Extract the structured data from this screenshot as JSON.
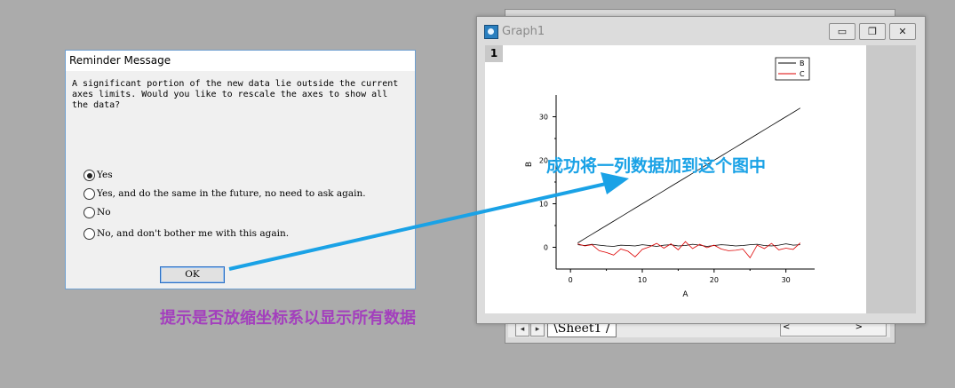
{
  "worksheet": {
    "sheet_tab": "Sheet1",
    "nav_prev": "◂",
    "nav_next": "▸",
    "scroll_left": "<",
    "scroll_right": ">"
  },
  "graph_window": {
    "title": "Graph1",
    "layer_number": "1",
    "minimize": "▭",
    "restore": "❐",
    "close": "✕"
  },
  "chart_data": {
    "type": "line",
    "xlabel": "A",
    "ylabel": "B",
    "xticks": [
      "0",
      "10",
      "20",
      "30"
    ],
    "yticks": [
      "0",
      "10",
      "20",
      "30"
    ],
    "xlim": [
      -2,
      34
    ],
    "ylim": [
      -5,
      35
    ],
    "x": [
      1,
      2,
      3,
      4,
      5,
      6,
      7,
      8,
      9,
      10,
      11,
      12,
      13,
      14,
      15,
      16,
      17,
      18,
      19,
      20,
      21,
      22,
      23,
      24,
      25,
      26,
      27,
      28,
      29,
      30,
      31,
      32
    ],
    "series": [
      {
        "name": "B",
        "color": "#000000",
        "lines": [
          {
            "x": [
              1,
              2,
              3,
              4,
              5,
              6,
              7,
              8,
              9,
              10,
              11,
              12,
              13,
              14,
              15,
              16,
              17,
              18,
              19,
              20,
              21,
              22,
              23,
              24,
              25,
              26,
              27,
              28,
              29,
              30,
              31,
              32
            ],
            "y": [
              1,
              2,
              3,
              4,
              5,
              6,
              7,
              8,
              9,
              10,
              11,
              12,
              13,
              14,
              15,
              16,
              17,
              18,
              19,
              20,
              21,
              22,
              23,
              24,
              25,
              26,
              27,
              28,
              29,
              30,
              31,
              32
            ]
          },
          {
            "x": [
              1,
              2,
              3,
              4,
              5,
              6,
              7,
              8,
              9,
              10,
              11,
              12,
              13,
              14,
              15,
              16,
              17,
              18,
              19,
              20,
              21,
              22,
              23,
              24,
              25,
              26,
              27,
              28,
              29,
              30,
              31,
              32
            ],
            "y": [
              0.6,
              0.4,
              0.7,
              0.5,
              0.3,
              0.2,
              0.5,
              0.4,
              0.3,
              0.6,
              0.4,
              0.2,
              0.5,
              0.6,
              0.3,
              0.4,
              0.7,
              0.5,
              0.2,
              0.4,
              0.6,
              0.5,
              0.3,
              0.4,
              0.6,
              0.7,
              0.4,
              0.3,
              0.5,
              0.8,
              0.5,
              0.6
            ]
          }
        ]
      },
      {
        "name": "C",
        "color": "#dd0000",
        "lines": [
          {
            "x": [
              1,
              2,
              3,
              4,
              5,
              6,
              7,
              8,
              9,
              10,
              11,
              12,
              13,
              14,
              15,
              16,
              17,
              18,
              19,
              20,
              21,
              22,
              23,
              24,
              25,
              26,
              27,
              28,
              29,
              30,
              31,
              32
            ],
            "y": [
              0.8,
              0.3,
              0.6,
              -0.8,
              -1.2,
              -1.8,
              -0.4,
              -0.9,
              -2.2,
              -0.5,
              0.1,
              0.9,
              -0.2,
              0.8,
              -0.6,
              1.3,
              -0.3,
              0.7,
              -0.1,
              0.5,
              -0.4,
              -0.8,
              -0.7,
              -0.4,
              -2.4,
              0.5,
              -0.3,
              0.9,
              -0.6,
              -0.2,
              -0.5,
              1.0
            ]
          }
        ]
      }
    ]
  },
  "dialog": {
    "title": "Reminder Message",
    "message": "A significant portion of the new data lie outside the current\naxes limits. Would you like to rescale the axes to show all\nthe data?",
    "options": [
      {
        "label": "Yes",
        "selected": true
      },
      {
        "label": "Yes, and do the same in the future, no need to ask again.",
        "selected": false
      },
      {
        "label": "No",
        "selected": false
      },
      {
        "label": "No, and don't bother me with this again.",
        "selected": false
      }
    ],
    "ok_label": "OK"
  },
  "annotations": {
    "blue_text": "成功将一列数据加到这个图中",
    "purple_text": "提示是否放缩坐标系以显示所有数据",
    "arrow_color": "#1aa2e6",
    "blue_color": "#1aa2e6",
    "purple_color": "#a33fbd"
  }
}
